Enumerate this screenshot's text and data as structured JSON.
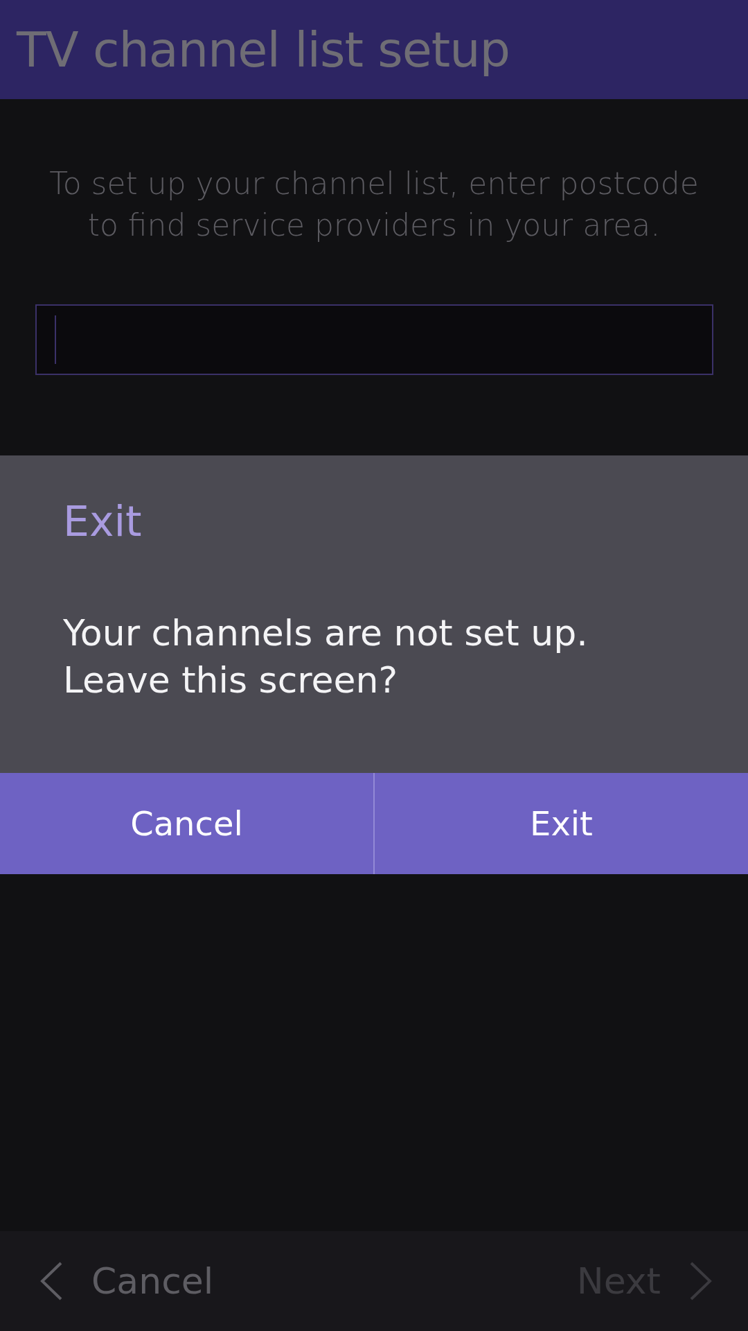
{
  "app_bar": {
    "title": "TV channel list setup"
  },
  "instructions": "To set up your channel list, enter postcode to find service providers in your area.",
  "postcode_field": {
    "focused": true
  },
  "dialog": {
    "title": "Exit",
    "message": "Your channels are not set up. Leave this screen?",
    "buttons": [
      "Cancel",
      "Exit"
    ]
  },
  "bottom_bar": [
    {
      "label": "Cancel",
      "kind": "back",
      "disabled": false
    },
    {
      "label": "Next",
      "kind": "forward",
      "disabled": true
    }
  ]
}
